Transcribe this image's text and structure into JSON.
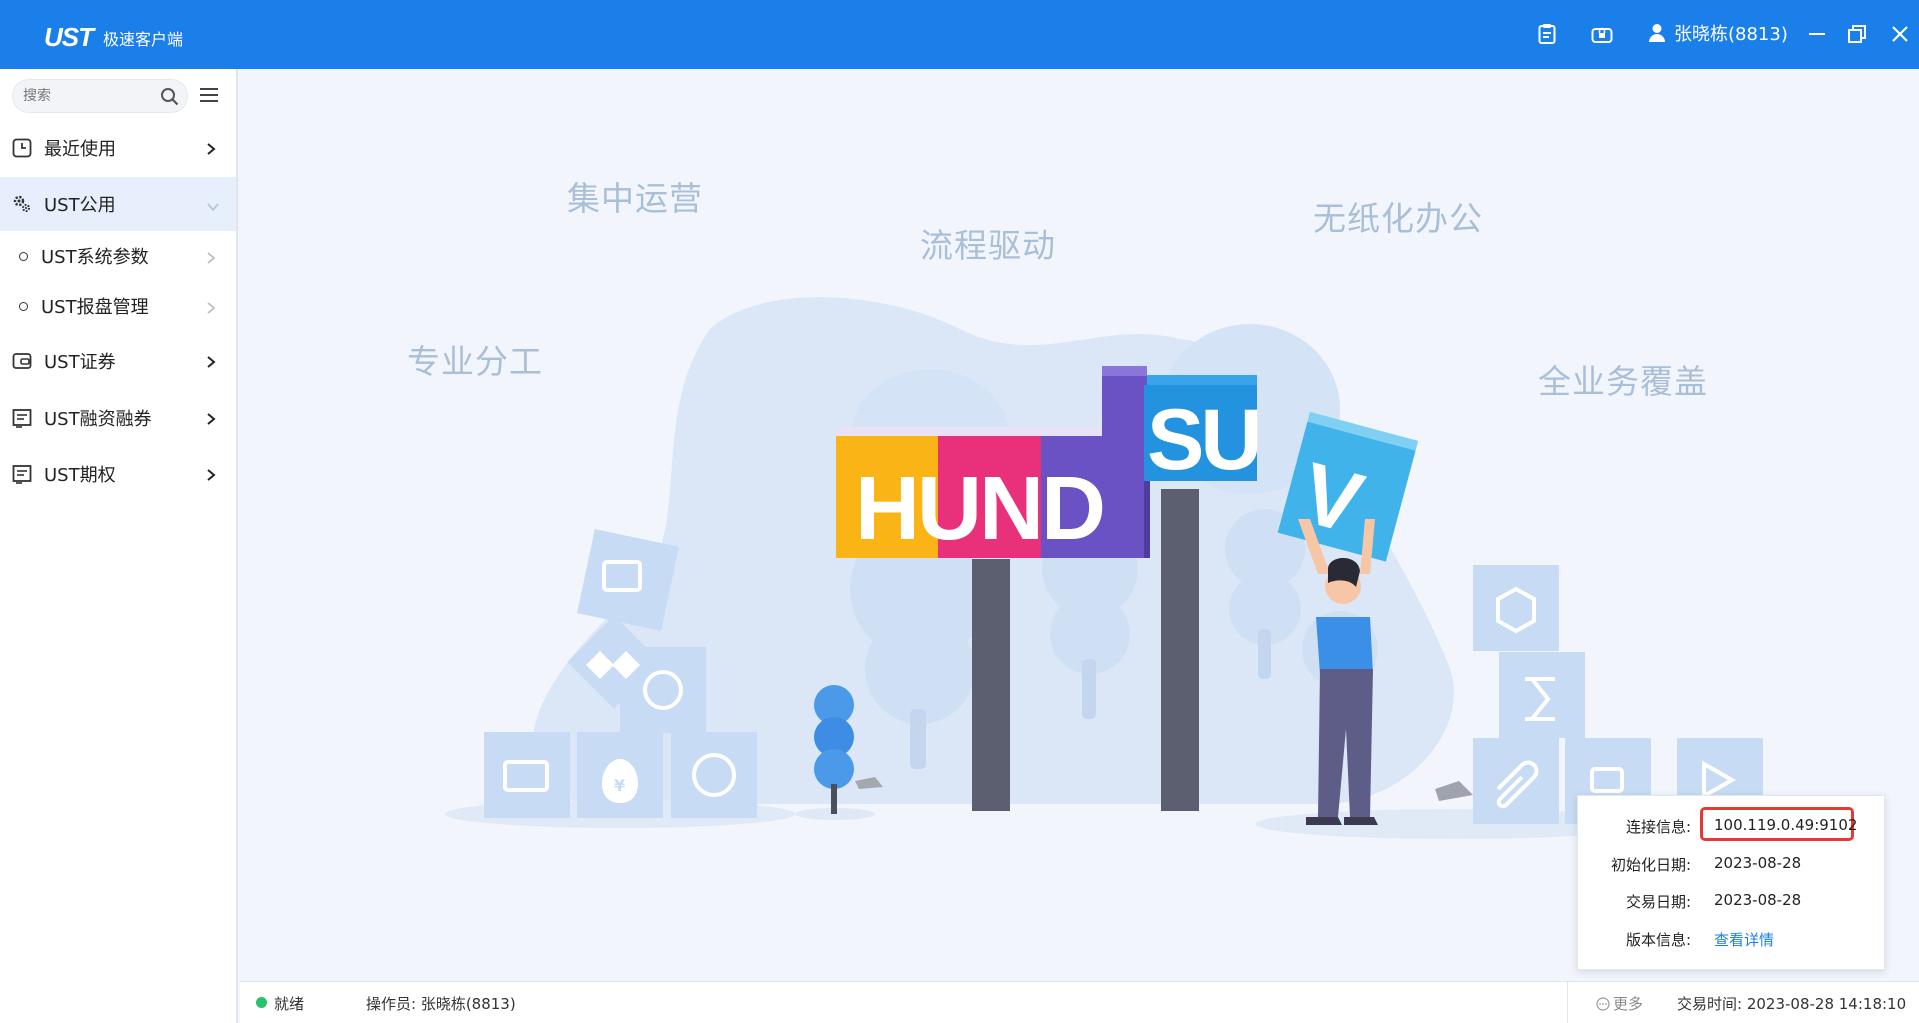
{
  "app": {
    "logo_mark": "UST",
    "title": "极速客户端",
    "user": "张晓栋(8813)"
  },
  "sidebar": {
    "search_placeholder": "搜索",
    "items": [
      {
        "label": "最近使用",
        "icon": "clock-icon"
      },
      {
        "label": "UST公用",
        "icon": "gears-icon",
        "expanded": true
      },
      {
        "label": "UST证券",
        "icon": "wallet-icon"
      },
      {
        "label": "UST融资融券",
        "icon": "list-doc-icon"
      },
      {
        "label": "UST期权",
        "icon": "list-doc-icon"
      }
    ],
    "sub_items": [
      {
        "label": "UST系统参数"
      },
      {
        "label": "UST报盘管理"
      }
    ]
  },
  "main": {
    "slogans": [
      "集中运营",
      "流程驱动",
      "无纸化办公",
      "专业分工",
      "全业务覆盖"
    ],
    "brand_left": "HUND",
    "brand_right": "SU",
    "brand_tile": "V"
  },
  "info_popup": {
    "rows": [
      {
        "label": "连接信息:",
        "value": "100.119.0.49:9102"
      },
      {
        "label": "初始化日期:",
        "value": "2023-08-28"
      },
      {
        "label": "交易日期:",
        "value": "2023-08-28"
      },
      {
        "label": "版本信息:",
        "value": "查看详情"
      }
    ]
  },
  "statusbar": {
    "status": "就绪",
    "operator": "操作员: 张晓栋(8813)",
    "more": "更多",
    "trade_time": "交易时间: 2023-08-28  14:18:10"
  },
  "colors": {
    "titlebar": "#1a7fe8",
    "accent": "#1a7fe8",
    "status_ok": "#27c26c",
    "highlight": "#e53935"
  }
}
